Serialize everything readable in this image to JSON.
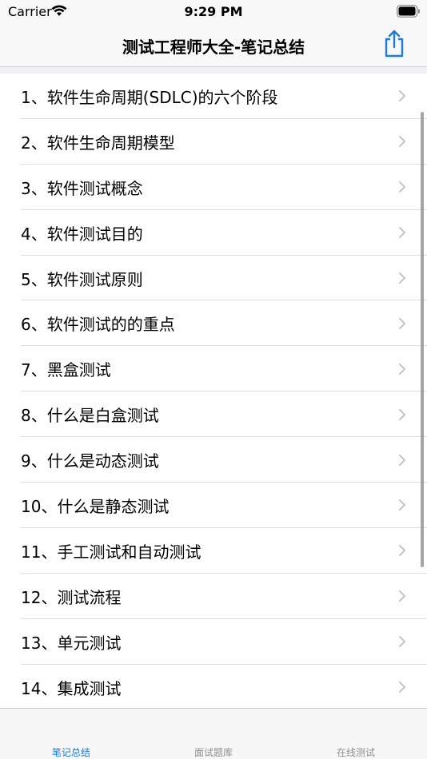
{
  "status_bar": {
    "carrier": "Carrier",
    "time": "9:29 PM"
  },
  "nav": {
    "title": "测试工程师大全-笔记总结"
  },
  "list": {
    "items": [
      {
        "label": "1、软件生命周期(SDLC)的六个阶段"
      },
      {
        "label": "2、软件生命周期模型"
      },
      {
        "label": "3、软件测试概念"
      },
      {
        "label": "4、软件测试目的"
      },
      {
        "label": "5、软件测试原则"
      },
      {
        "label": "6、软件测试的的重点"
      },
      {
        "label": "7、黑盒测试"
      },
      {
        "label": "8、什么是白盒测试"
      },
      {
        "label": "9、什么是动态测试"
      },
      {
        "label": "10、什么是静态测试"
      },
      {
        "label": "11、手工测试和自动测试"
      },
      {
        "label": "12、测试流程"
      },
      {
        "label": "13、单元测试"
      },
      {
        "label": "14、集成测试"
      }
    ]
  },
  "tabs": [
    {
      "label": "笔记总结",
      "active": true
    },
    {
      "label": "面试题库",
      "active": false
    },
    {
      "label": "在线测试",
      "active": false
    }
  ],
  "colors": {
    "accent": "#1a7ae6",
    "inactive": "#8e8e93",
    "chevron": "#c4c4c9"
  },
  "icons": {
    "share": "share-icon",
    "chevron": "chevron-right-icon",
    "wifi": "wifi-icon",
    "battery": "battery-icon"
  }
}
